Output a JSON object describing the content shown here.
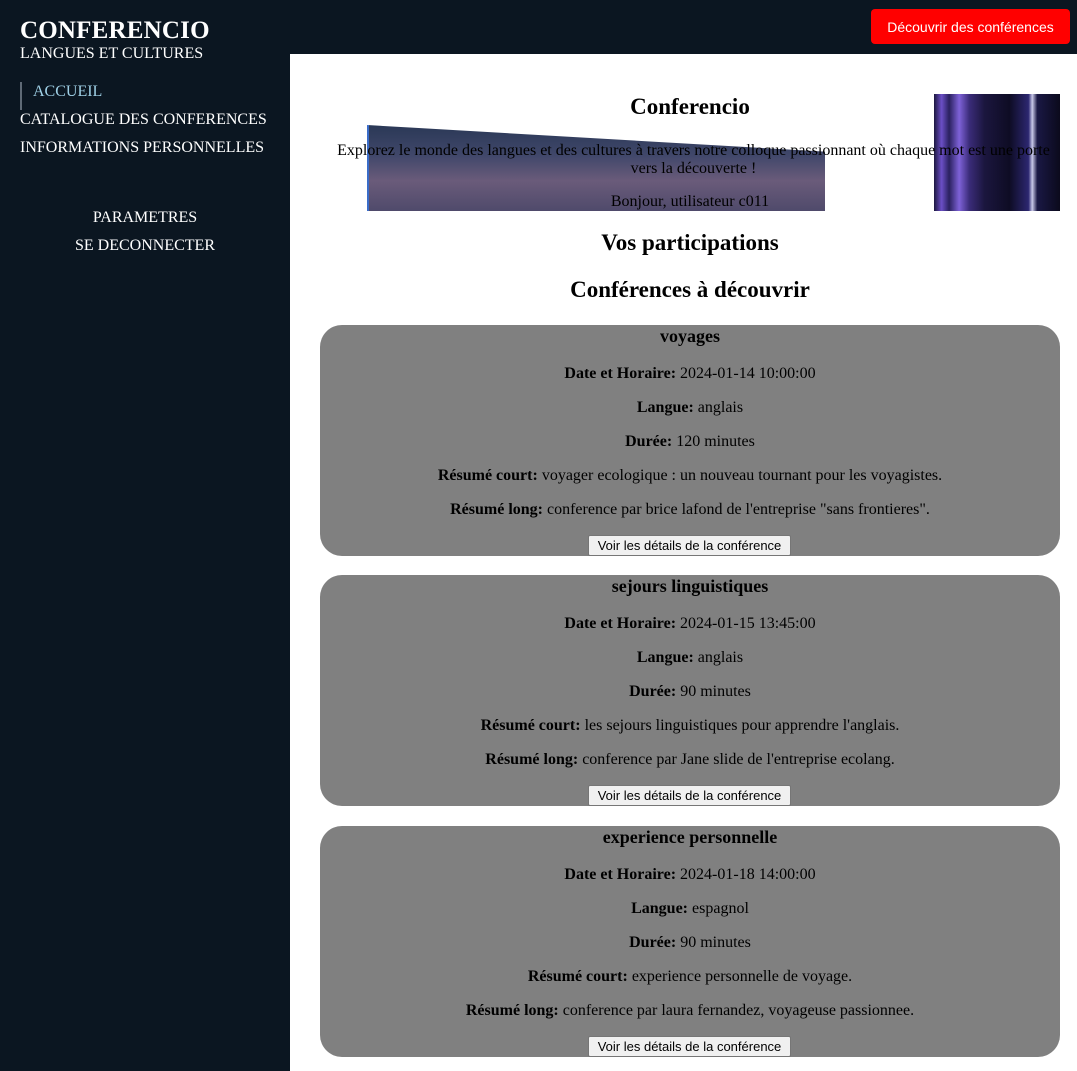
{
  "header": {
    "discover_button": "Découvrir des conférences"
  },
  "sidebar": {
    "brand_title": "CONFERENCIO",
    "brand_subtitle": "LANGUES ET CULTURES",
    "nav_items": [
      {
        "label": "ACCUEIL",
        "active": true
      },
      {
        "label": "CATALOGUE DES CONFERENCES",
        "active": false
      },
      {
        "label": "INFORMATIONS PERSONNELLES",
        "active": false
      }
    ],
    "secondary_items": [
      {
        "label": "PARAMETRES"
      },
      {
        "label": "SE DECONNECTER"
      }
    ]
  },
  "hero": {
    "title": "Conferencio",
    "text": "Explorez le monde des langues et des cultures à travers notre colloque passionnant où chaque mot est une porte vers la découverte !",
    "greeting": "Bonjour, utilisateur c011"
  },
  "sections": {
    "participations_title": "Vos participations",
    "discover_title": "Conférences à découvrir"
  },
  "labels": {
    "date": "Date et Horaire:",
    "language": "Langue:",
    "duration": "Durée:",
    "short_summary": "Résumé court:",
    "long_summary": "Résumé long:",
    "details_button": "Voir les détails de la conférence"
  },
  "conferences": [
    {
      "title": "voyages",
      "date": "2024-01-14 10:00:00",
      "language": "anglais",
      "duration": "120 minutes",
      "short_summary": "voyager ecologique : un nouveau tournant pour les voyagistes.",
      "long_summary": "conference par brice lafond de l'entreprise \"sans frontieres\"."
    },
    {
      "title": "sejours linguistiques",
      "date": "2024-01-15 13:45:00",
      "language": "anglais",
      "duration": "90 minutes",
      "short_summary": "les sejours linguistiques pour apprendre l'anglais.",
      "long_summary": "conference par Jane slide de l'entreprise ecolang."
    },
    {
      "title": "experience personnelle",
      "date": "2024-01-18 14:00:00",
      "language": "espagnol",
      "duration": "90 minutes",
      "short_summary": "experience personnelle de voyage.",
      "long_summary": "conference par laura fernandez, voyageuse passionnee."
    }
  ]
}
